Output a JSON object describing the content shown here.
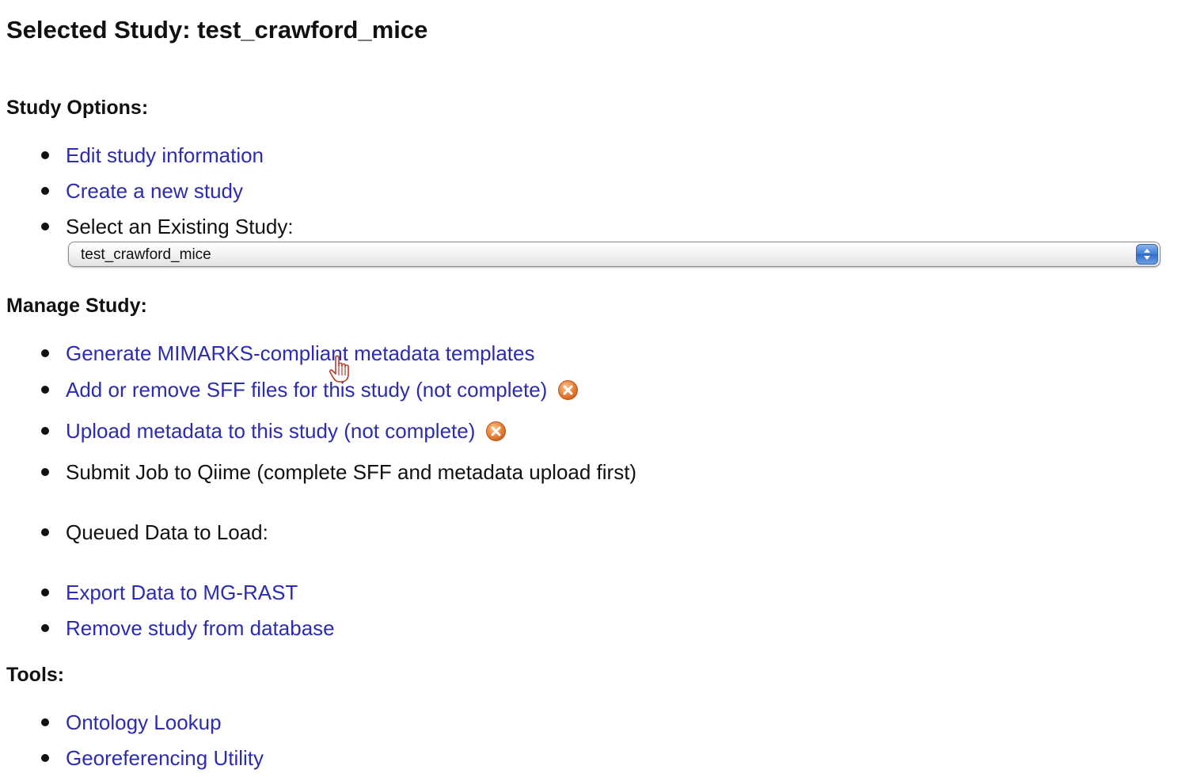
{
  "page": {
    "title": "Selected Study: test_crawford_mice"
  },
  "study_options": {
    "heading": "Study Options:",
    "edit_study_label": "Edit study information",
    "create_study_label": "Create a new study",
    "select_existing_label": "Select an Existing Study:",
    "study_select": {
      "selected_value": "test_crawford_mice"
    }
  },
  "manage_study": {
    "heading": "Manage Study:",
    "generate_templates_label": "Generate MIMARKS-compliant metadata templates",
    "sff_files_label": "Add or remove SFF files for this study (not complete)",
    "upload_metadata_label": "Upload metadata to this study (not complete)",
    "submit_job_label": "Submit Job to Qiime (complete SFF and metadata upload first)",
    "queued_data_label": "Queued Data to Load:",
    "export_label": "Export Data to MG-RAST",
    "remove_label": "Remove study from database"
  },
  "tools": {
    "heading": "Tools:",
    "ontology_label": "Ontology Lookup",
    "georeferencing_label": "Georeferencing Utility"
  },
  "icons": {
    "incomplete_status": "incomplete-x-icon",
    "pointer": "hand-pointer-cursor-icon",
    "select_arrows": "select-arrows-icon"
  },
  "colors": {
    "link": "#2b2bb3",
    "text": "#111111",
    "incomplete_icon": "#e8823a",
    "select_arrows": "#3d7bd6"
  }
}
